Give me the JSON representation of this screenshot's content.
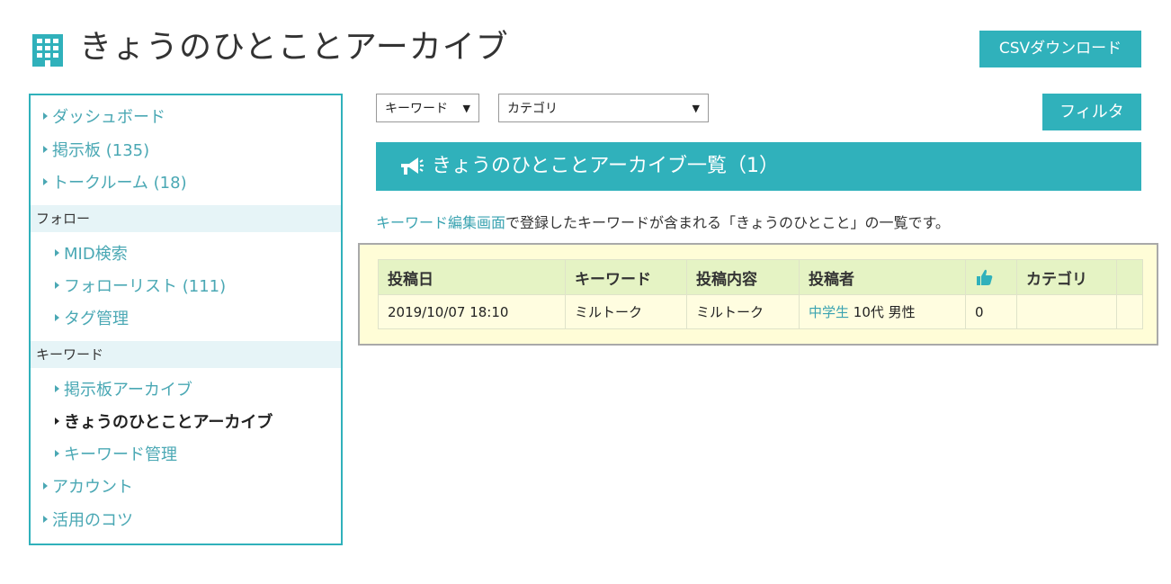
{
  "header": {
    "title": "きょうのひとことアーカイブ",
    "icon": "building-icon",
    "csv_button": "CSVダウンロード"
  },
  "sidebar": {
    "items_top": [
      {
        "label": "ダッシュボード"
      },
      {
        "label": "掲示板 (135)"
      },
      {
        "label": "トークルーム (18)"
      }
    ],
    "section_follow": "フォロー",
    "follow_items": [
      {
        "label": "MID検索"
      },
      {
        "label": "フォローリスト (111)"
      },
      {
        "label": "タグ管理"
      }
    ],
    "section_keyword": "キーワード",
    "keyword_items": [
      {
        "label": "掲示板アーカイブ"
      },
      {
        "label": "きょうのひとことアーカイブ",
        "active": true
      },
      {
        "label": "キーワード管理"
      }
    ],
    "items_bottom": [
      {
        "label": "アカウント"
      },
      {
        "label": "活用のコツ"
      }
    ]
  },
  "filters": {
    "keyword_select": "キーワード",
    "category_select": "カテゴリ",
    "filter_button": "フィルタ"
  },
  "banner": {
    "icon": "megaphone-icon",
    "title": "きょうのひとことアーカイブ一覧（1）"
  },
  "description": {
    "link_text": "キーワード編集画面",
    "text": "で登録したキーワードが含まれる「きょうのひとこと」の一覧です。"
  },
  "table": {
    "headers": [
      "投稿日",
      "キーワード",
      "投稿内容",
      "投稿者",
      "",
      "カテゴリ",
      ""
    ],
    "like_icon": "thumbs-up-icon",
    "rows": [
      {
        "date": "2019/10/07 18:10",
        "keyword": "ミルトーク",
        "content": "ミルトーク",
        "author_link": "中学生",
        "author_rest": "10代 男性",
        "likes": "0",
        "category": ""
      }
    ]
  },
  "colors": {
    "accent": "#30b1bb",
    "link": "#3aa3b1",
    "section_bg": "#e6f4f7",
    "table_bg": "#fffdd7",
    "table_header_bg": "#e5f3c4"
  }
}
